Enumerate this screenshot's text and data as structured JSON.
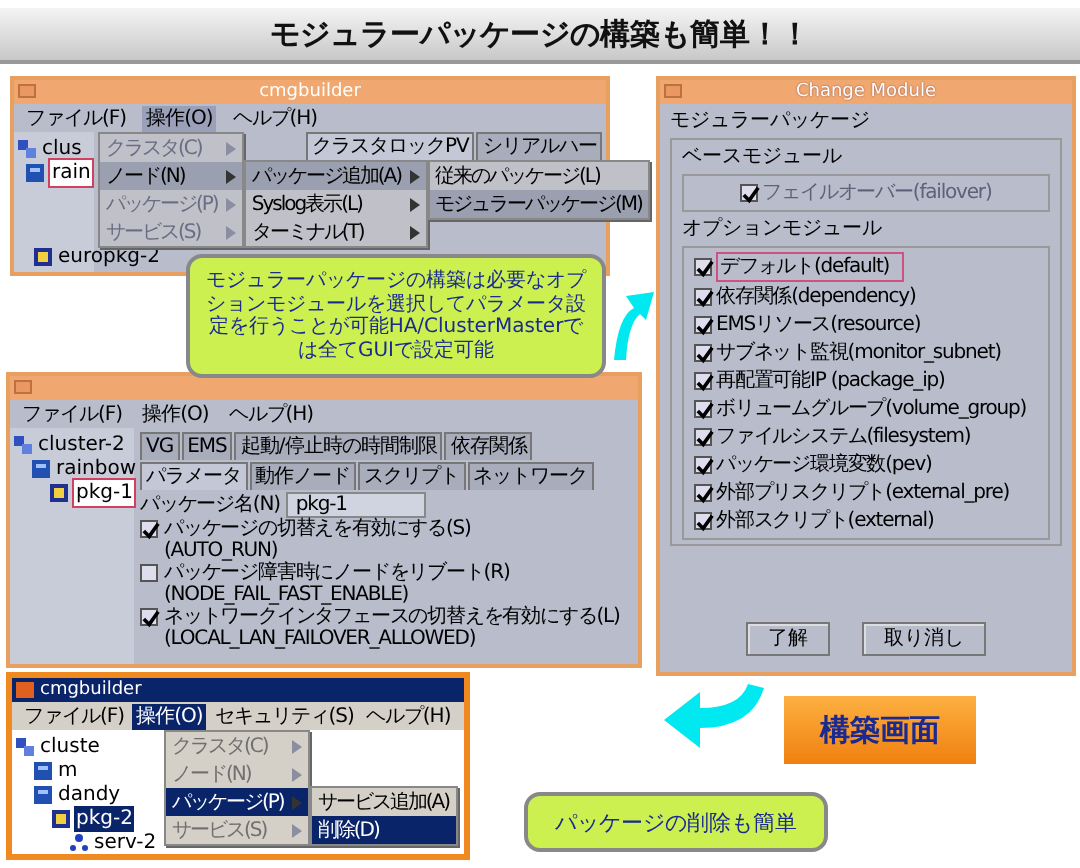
{
  "banner": {
    "title": "モジュラーパッケージの構築も簡単！！"
  },
  "builder_window": {
    "title": "cmgbuilder",
    "menu": [
      {
        "label": "ファイル(F)",
        "selected": false
      },
      {
        "label": "操作(O)",
        "selected": true
      },
      {
        "label": "ヘルプ(H)",
        "selected": false
      }
    ],
    "tree": [
      {
        "label": "clus",
        "kind": "cluster",
        "selected": false,
        "children": [
          {
            "label": "rain",
            "kind": "node",
            "selected": true,
            "children": [
              {
                "label": "europkg-2",
                "kind": "package",
                "selected": false
              }
            ]
          }
        ]
      }
    ],
    "tabs": [
      {
        "label": "クラスタロックPV",
        "selected": true
      },
      {
        "label": "シリアルハー",
        "selected": false
      }
    ],
    "menus": [
      [
        {
          "label": "クラスタ(C)",
          "selected": false,
          "disabled": true
        },
        {
          "label": "ノード(N)",
          "selected": true,
          "disabled": false
        },
        {
          "label": "パッケージ(P)",
          "selected": false,
          "disabled": true
        },
        {
          "label": "サービス(S)",
          "selected": false,
          "disabled": true
        }
      ],
      [
        {
          "label": "パッケージ追加(A)",
          "selected": true,
          "disabled": false
        },
        {
          "label": "Syslog表示(L)",
          "selected": false,
          "disabled": false
        },
        {
          "label": "ターミナル(T)",
          "selected": false,
          "disabled": false
        }
      ],
      [
        {
          "label": "従来のパッケージ(L)",
          "selected": false,
          "disabled": false
        },
        {
          "label": "モジュラーパッケージ(M)",
          "selected": true,
          "disabled": false
        }
      ]
    ]
  },
  "package_window": {
    "menu": [
      {
        "label": "ファイル(F)",
        "selected": false
      },
      {
        "label": "操作(O)",
        "selected": false
      },
      {
        "label": "ヘルプ(H)",
        "selected": false
      }
    ],
    "tree": [
      {
        "label": "cluster-2",
        "kind": "cluster",
        "selected": false,
        "children": [
          {
            "label": "rainbow",
            "kind": "node",
            "selected": false,
            "children": [
              {
                "label": "pkg-1",
                "kind": "package",
                "selected": true
              }
            ]
          }
        ]
      }
    ],
    "tab_rows": [
      [
        {
          "label": "VG",
          "selected": false
        },
        {
          "label": "EMS",
          "selected": false
        },
        {
          "label": "起動/停止時の時間制限",
          "selected": false
        },
        {
          "label": "依存関係",
          "selected": false
        }
      ],
      [
        {
          "label": "パラメータ",
          "selected": true
        },
        {
          "label": "動作ノード",
          "selected": false
        },
        {
          "label": "スクリプト",
          "selected": false
        },
        {
          "label": "ネットワーク",
          "selected": false
        }
      ]
    ],
    "name_label": "パッケージ名(N)",
    "name_value": "pkg-1",
    "options": [
      {
        "label": "パッケージの切替えを有効にする(S)",
        "code": "(AUTO_RUN)",
        "checked": true
      },
      {
        "label": "パッケージ障害時にノードをリブート(R)",
        "code": "(NODE_FAIL_FAST_ENABLE)",
        "checked": false
      },
      {
        "label": "ネットワークインタフェースの切替えを有効にする(L)",
        "code": "(LOCAL_LAN_FAILOVER_ALLOWED)",
        "checked": true
      }
    ]
  },
  "delete_window": {
    "title": "cmgbuilder",
    "menu": [
      {
        "label": "ファイル(F)",
        "selected": false
      },
      {
        "label": "操作(O)",
        "selected": true
      },
      {
        "label": "セキュリティ(S)",
        "selected": false
      },
      {
        "label": "ヘルプ(H)",
        "selected": false
      }
    ],
    "tree": [
      {
        "label": "cluste",
        "kind": "cluster",
        "selected": false,
        "children": [
          {
            "label": "m",
            "kind": "node",
            "selected": false
          },
          {
            "label": "dandy",
            "kind": "node",
            "selected": false,
            "children": [
              {
                "label": "pkg-2",
                "kind": "package",
                "selected": true,
                "children": [
                  {
                    "label": "serv-2",
                    "kind": "service",
                    "selected": false
                  }
                ]
              }
            ]
          }
        ]
      }
    ],
    "menus": [
      [
        {
          "label": "クラスタ(C)",
          "selected": false,
          "disabled": true
        },
        {
          "label": "ノード(N)",
          "selected": false,
          "disabled": true
        },
        {
          "label": "パッケージ(P)",
          "selected": true,
          "disabled": false
        },
        {
          "label": "サービス(S)",
          "selected": false,
          "disabled": true
        }
      ],
      [
        {
          "label": "サービス追加(A)",
          "selected": false,
          "disabled": false
        },
        {
          "label": "削除(D)",
          "selected": true,
          "disabled": false
        }
      ]
    ]
  },
  "change_module": {
    "title": "Change Module",
    "heading": "モジュラーパッケージ",
    "base": {
      "label": "ベースモジュール",
      "items": [
        {
          "label": "フェイルオーバー(failover)",
          "checked": true,
          "disabled": true,
          "focused": false
        }
      ]
    },
    "optional": {
      "label": "オプションモジュール",
      "items": [
        {
          "label": "デフォルト(default)",
          "checked": true,
          "disabled": false,
          "focused": true
        },
        {
          "label": "依存関係(dependency)",
          "checked": true,
          "disabled": false,
          "focused": false
        },
        {
          "label": "EMSリソース(resource)",
          "checked": true,
          "disabled": false,
          "focused": false
        },
        {
          "label": "サブネット監視(monitor_subnet)",
          "checked": true,
          "disabled": false,
          "focused": false
        },
        {
          "label": "再配置可能IP (package_ip)",
          "checked": true,
          "disabled": false,
          "focused": false
        },
        {
          "label": "ボリュームグループ(volume_group)",
          "checked": true,
          "disabled": false,
          "focused": false
        },
        {
          "label": "ファイルシステム(filesystem)",
          "checked": true,
          "disabled": false,
          "focused": false
        },
        {
          "label": "パッケージ環境変数(pev)",
          "checked": true,
          "disabled": false,
          "focused": false
        },
        {
          "label": "外部プリスクリプト(external_pre)",
          "checked": true,
          "disabled": false,
          "focused": false
        },
        {
          "label": "外部スクリプト(external)",
          "checked": true,
          "disabled": false,
          "focused": false
        }
      ]
    },
    "buttons": [
      "了解",
      "取り消し"
    ]
  },
  "callouts": [
    {
      "text": "モジュラーパッケージの構築は必要なオプションモジュールを選択してパラメータ設定を行うことが可能HA/ClusterMasterでは全てGUIで設定可能"
    },
    {
      "text": "パッケージの削除も簡単"
    }
  ],
  "label_box": {
    "text": "構築画面"
  }
}
